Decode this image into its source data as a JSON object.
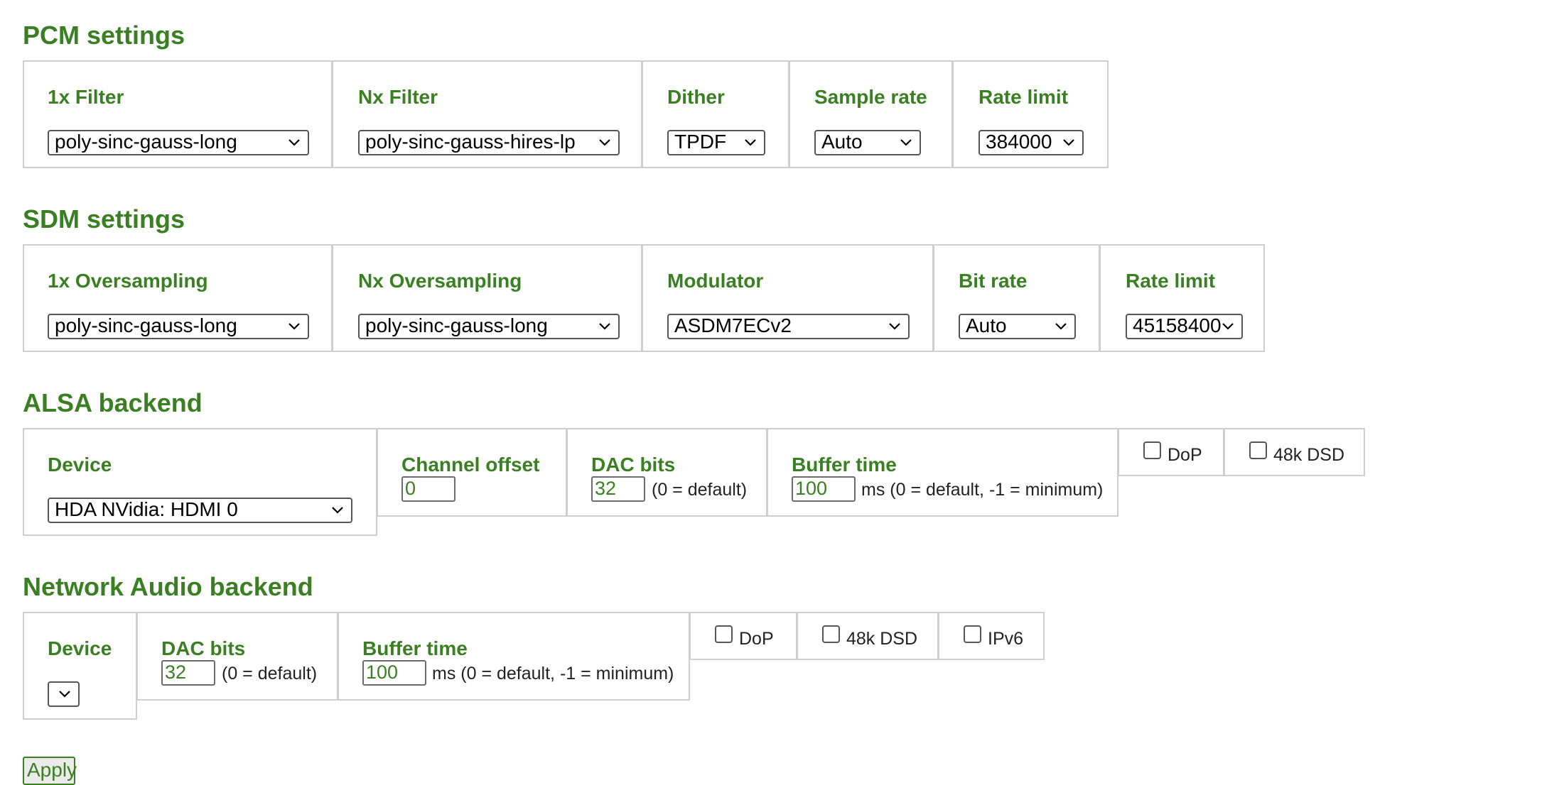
{
  "sections": {
    "pcm": {
      "title": "PCM settings",
      "filter_1x": {
        "label": "1x Filter",
        "value": "poly-sinc-gauss-long"
      },
      "filter_nx": {
        "label": "Nx Filter",
        "value": "poly-sinc-gauss-hires-lp"
      },
      "dither": {
        "label": "Dither",
        "value": "TPDF"
      },
      "sample_rate": {
        "label": "Sample rate",
        "value": "Auto"
      },
      "rate_limit": {
        "label": "Rate limit",
        "value": "384000"
      }
    },
    "sdm": {
      "title": "SDM settings",
      "oversampling_1x": {
        "label": "1x Oversampling",
        "value": "poly-sinc-gauss-long"
      },
      "oversampling_nx": {
        "label": "Nx Oversampling",
        "value": "poly-sinc-gauss-long"
      },
      "modulator": {
        "label": "Modulator",
        "value": "ASDM7ECv2"
      },
      "bit_rate": {
        "label": "Bit rate",
        "value": "Auto"
      },
      "rate_limit": {
        "label": "Rate limit",
        "value": "45158400"
      }
    },
    "alsa": {
      "title": "ALSA backend",
      "device": {
        "label": "Device",
        "value": "HDA NVidia: HDMI 0"
      },
      "channel_offset": {
        "label": "Channel offset",
        "value": "0"
      },
      "dac_bits": {
        "label": "DAC bits",
        "value": "32",
        "note": "(0 = default)"
      },
      "buffer_time": {
        "label": "Buffer time",
        "value": "100",
        "note": "ms (0 = default, -1 = minimum)"
      },
      "dop": {
        "label": "DoP",
        "checked": false
      },
      "dsd48k": {
        "label": "48k DSD",
        "checked": false
      }
    },
    "network": {
      "title": "Network Audio backend",
      "device": {
        "label": "Device",
        "value": ""
      },
      "dac_bits": {
        "label": "DAC bits",
        "value": "32",
        "note": "(0 = default)"
      },
      "buffer_time": {
        "label": "Buffer time",
        "value": "100",
        "note": "ms (0 = default, -1 = minimum)"
      },
      "dop": {
        "label": "DoP",
        "checked": false
      },
      "dsd48k": {
        "label": "48k DSD",
        "checked": false
      },
      "ipv6": {
        "label": "IPv6",
        "checked": false
      }
    }
  },
  "apply_label": "Apply",
  "colors": {
    "accent": "#3a8022",
    "border": "#cfcfcf",
    "text": "#222222"
  }
}
